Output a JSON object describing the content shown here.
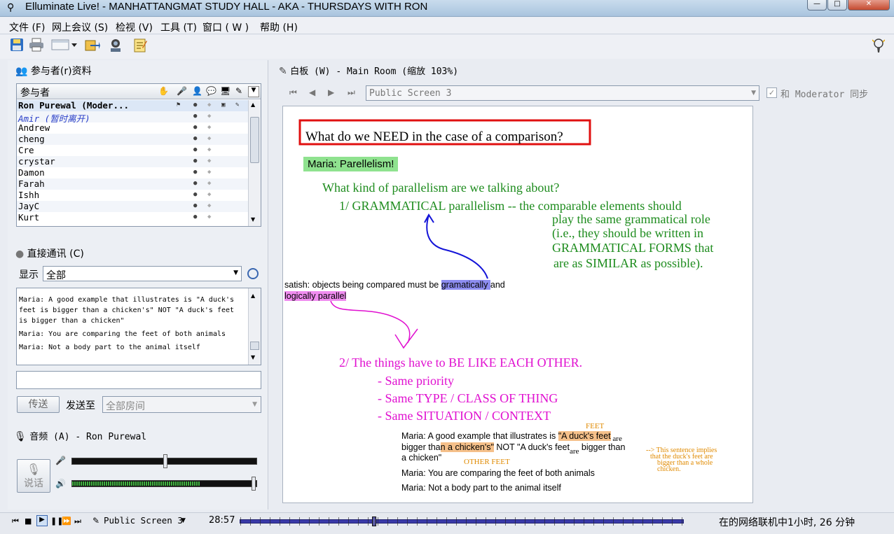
{
  "window": {
    "title": "Elluminate Live! - MANHATTANGMAT STUDY HALL - AKA - THURSDAYS WITH RON",
    "min_glyph": "—",
    "max_glyph": "□",
    "close_glyph": "✕"
  },
  "menu": [
    "文件 (F)",
    "网上会议 (S)",
    "检视 (V)",
    "工具 (T)",
    "窗口 ( W )",
    "帮助 (H)"
  ],
  "toolbar": {
    "icons": [
      "save-icon",
      "print-icon",
      "layout-icon",
      "transfer-icon",
      "webcam-icon",
      "notes-icon"
    ]
  },
  "participants": {
    "title": "参与者(r)资料",
    "header_label": "参与者",
    "rows": [
      {
        "name": "Ron Purewal (Moder...",
        "style": "bold"
      },
      {
        "name": "Amir (暂时离开)",
        "style": "away"
      },
      {
        "name": "Andrew",
        "style": "normal"
      },
      {
        "name": "cheng",
        "style": "normal"
      },
      {
        "name": "Cre",
        "style": "normal"
      },
      {
        "name": "crystar",
        "style": "normal"
      },
      {
        "name": "Damon",
        "style": "normal"
      },
      {
        "name": "Farah",
        "style": "normal"
      },
      {
        "name": "Ishh",
        "style": "normal"
      },
      {
        "name": "JayC",
        "style": "normal"
      },
      {
        "name": "Kurt",
        "style": "normal"
      }
    ]
  },
  "chat": {
    "title": "直接通讯 (C)",
    "show_label": "显示",
    "filter_value": "全部",
    "messages": [
      "Maria: A good example that illustrates is \"A duck's feet is bigger than a chicken's\" NOT \"A duck's feet is bigger than a chicken\"",
      "Maria: You are comparing the feet of both animals",
      "Maria: Not a body part to the animal itself"
    ],
    "input_value": "",
    "send_label": "传送",
    "send_to_label": "发送至",
    "send_to_value": "全部房间"
  },
  "audio": {
    "title": "音频 (A) - Ron Purewal",
    "talk_label": "说话",
    "mic_level": 0.5,
    "speaker_level": 0.99
  },
  "whiteboard": {
    "title": "白板 (W) - Main Room (缩放 103%)",
    "screen_select": "Public Screen 3",
    "sync_label": "和 Moderator 同步",
    "sync_checked": true,
    "question": "What do we NEED in the case of a comparison?",
    "maria_tag": "Maria: Parellelism!",
    "kind_question": "What kind of parallelism are we talking about?",
    "point1_head": "1/  GRAMMATICAL parallelism -- the comparable elements should",
    "point1_lines": [
      "play the same grammatical role",
      "(i.e., they should be written in",
      "GRAMMATICAL FORMS that",
      "are as SIMILAR as possible)."
    ],
    "satish_text_a": "satish: objects being compared must be ",
    "satish_highlight_blue": "gramatically ",
    "satish_text_b": "and",
    "satish_highlight_pink": "logically parallel",
    "point2_head": "2/  The things have to BE LIKE EACH OTHER.",
    "point2_items": [
      "- Same priority",
      "- Same TYPE / CLASS OF THING",
      "- Same SITUATION / CONTEXT"
    ],
    "feet_label": "FEET",
    "other_feet_label": "OTHER FEET",
    "ex_line1_a": "Maria: A good example that illustrates is ",
    "ex_line1_hl": "\"A duck's feet",
    "ex_line1_sub": " are",
    "ex_line2_a": "bigger tha",
    "ex_line2_hl": "n a chicken's\"",
    "ex_line2_b": " NOT \"A duck's feet",
    "ex_line2_sub": "are",
    "ex_line2_c": " bigger than",
    "ex_line3": "a chicken\"",
    "ex_line4": "Maria: You are comparing the feet of both animals",
    "ex_line5": "Maria: Not a body part to the animal itself",
    "side_note": [
      "--> This sentence implies",
      "that the duck's feet are",
      "bigger than a whole",
      "chicken."
    ]
  },
  "statusbar": {
    "screen_label": "Public Screen 3",
    "time": "28:57",
    "progress": 0.3,
    "online_text": "在的网络联机中1小时, 26 分钟"
  },
  "colors": {
    "whiteboard_green": "#1e8c1e",
    "whiteboard_magenta": "#e010d0",
    "question_box": "#e01010",
    "maria_tag_bg": "#8fe28f",
    "highlight_blue": "#8c8cf0",
    "highlight_pink": "#f08cf0",
    "highlight_orange": "#f5c08a",
    "annotation_orange": "#e08a00"
  }
}
